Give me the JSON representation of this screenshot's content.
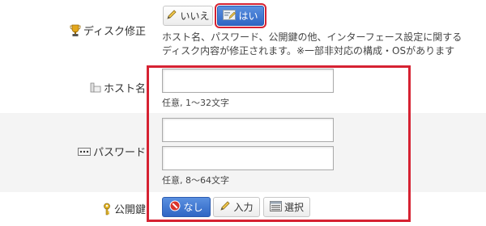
{
  "disk_fix": {
    "label": "ディスク修正",
    "icon": "trophy-icon",
    "options": [
      {
        "label": "いいえ",
        "icon": "pencil-icon",
        "selected": false
      },
      {
        "label": "はい",
        "icon": "edit-card-icon",
        "selected": true
      }
    ],
    "description_line1": "ホスト名、パスワード、公開鍵の他、インターフェース設定に関する",
    "description_line2": "ディスク内容が修正されます。※一部非対応の構成・OSがあります"
  },
  "hostname": {
    "label": "ホスト名",
    "icon": "server-icon",
    "value": "",
    "hint": "任意, 1〜32文字"
  },
  "password": {
    "label": "パスワード",
    "icon": "password-dots-icon",
    "value": "",
    "confirm_value": "",
    "hint": "任意, 8〜64文字"
  },
  "public_key": {
    "label": "公開鍵",
    "icon": "key-icon",
    "options": [
      {
        "label": "なし",
        "icon": "no-entry-icon",
        "selected": true
      },
      {
        "label": "入力",
        "icon": "pencil-icon",
        "selected": false
      },
      {
        "label": "選択",
        "icon": "list-icon",
        "selected": false
      }
    ]
  },
  "colors": {
    "highlight_red": "#d62232",
    "selected_blue": "#2f66c4",
    "alt_row_bg": "#f4f4f4"
  }
}
